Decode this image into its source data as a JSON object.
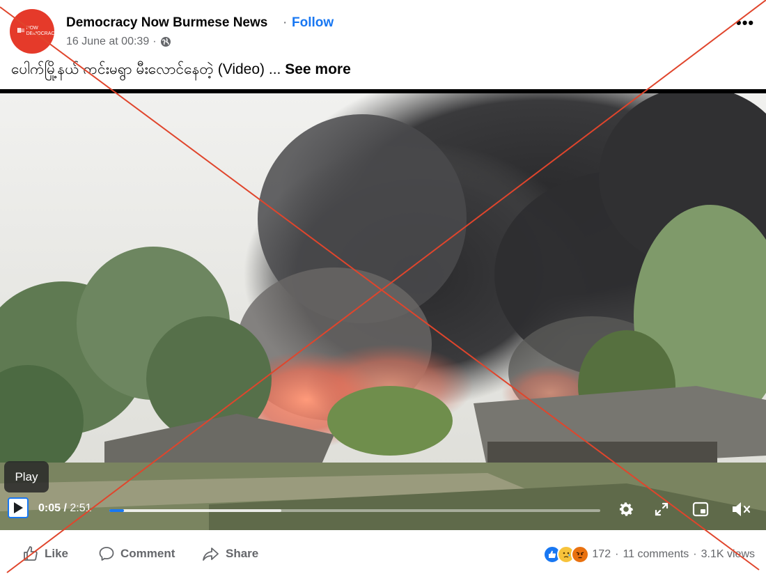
{
  "post": {
    "page_name": "Democracy Now Burmese News",
    "separator": "·",
    "follow_label": "Follow",
    "timestamp": "16 June at 00:39",
    "meta_separator": "·",
    "audience_icon": "globe-icon",
    "more_label": "•••",
    "avatar_text": "NOW DEMOCRACY",
    "caption": "ပေါက်မြို့နယ် ကင်းမရွာ မီးလောင်နေတဲ့ (Video) ... ",
    "see_more_label": "See more"
  },
  "video": {
    "play_tooltip": "Play",
    "current_time": "0:05",
    "time_separator": " / ",
    "duration": "2:51",
    "progress_fraction": 0.03,
    "buffered_fraction": 0.35,
    "controls": [
      "settings-icon",
      "fullscreen-icon",
      "picture-in-picture-icon",
      "mute-icon"
    ]
  },
  "actions": {
    "like_label": "Like",
    "comment_label": "Comment",
    "share_label": "Share"
  },
  "stats": {
    "reaction_count": "172",
    "sep1": "·",
    "comments": "11 comments",
    "sep2": "·",
    "views": "3.1K views",
    "reaction_icons": [
      "like-reaction-icon",
      "care-reaction-icon",
      "angry-reaction-icon"
    ]
  },
  "colors": {
    "accent": "#1877f2",
    "overlay_cross": "#e0452c",
    "avatar": "#e53a2a"
  }
}
